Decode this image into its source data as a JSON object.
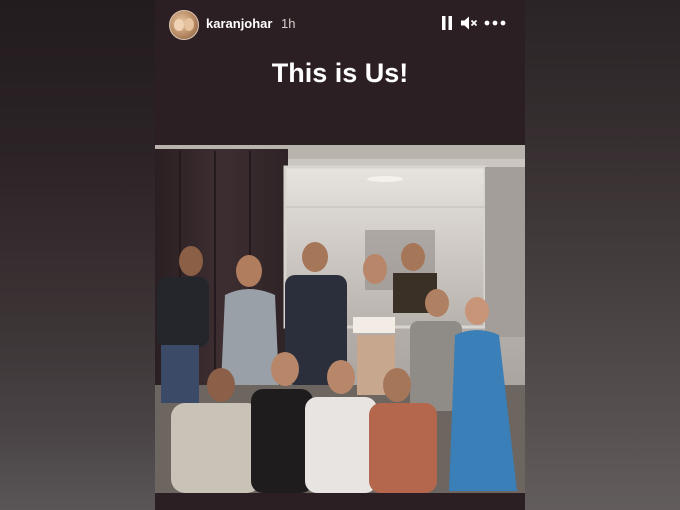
{
  "story": {
    "username": "karanjohar",
    "time": "1h",
    "caption": "This is Us!"
  },
  "icons": {
    "avatar": "profile-avatar",
    "pause": "pause-icon",
    "mute": "speaker-muted-icon",
    "more": "more-horizontal-icon"
  },
  "colors": {
    "story_bg": "#2c1f24",
    "text": "#ffffff"
  }
}
